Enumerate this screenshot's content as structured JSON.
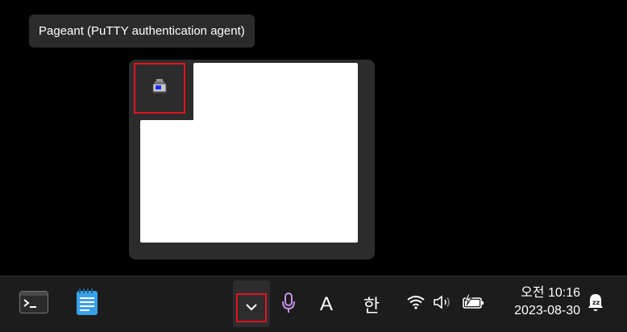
{
  "tooltip": {
    "text": "Pageant (PuTTY authentication agent)"
  },
  "overflow_tray": {
    "icons": [
      {
        "name": "pageant-icon",
        "tooltip_ref": "tooltip.text"
      }
    ]
  },
  "taskbar": {
    "apps": [
      {
        "icon": "terminal-icon"
      },
      {
        "icon": "notepad-icon"
      }
    ],
    "tray": {
      "overflow_icon": "chevron-up-icon",
      "mic_icon": "microphone-icon",
      "ime_mode": "A",
      "ime_lang": "한",
      "wifi_icon": "wifi-icon",
      "volume_icon": "volume-icon",
      "battery_icon": "battery-charging-icon"
    },
    "clock": {
      "time": "오전 10:16",
      "date": "2023-08-30"
    },
    "notification_icon": "notification-bell-icon"
  },
  "colors": {
    "highlight": "#e0141e",
    "taskbar_bg": "#1c1c1c",
    "mic": "#c792ea"
  }
}
